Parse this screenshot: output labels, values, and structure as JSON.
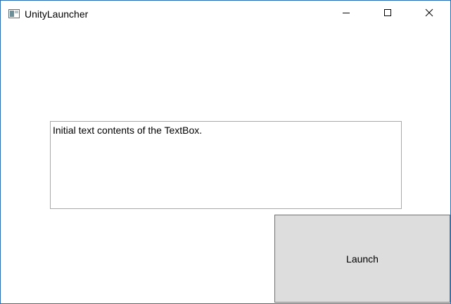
{
  "window": {
    "title": "UnityLauncher",
    "app_icon": "window-app-icon",
    "border_color": "#2b6fb6"
  },
  "caption_buttons": {
    "minimize_icon": "minimize-icon",
    "maximize_icon": "maximize-icon",
    "close_icon": "close-icon"
  },
  "textbox": {
    "value": "Initial text contents of the TextBox."
  },
  "launch": {
    "label": "Launch",
    "background": "#dddddd"
  }
}
